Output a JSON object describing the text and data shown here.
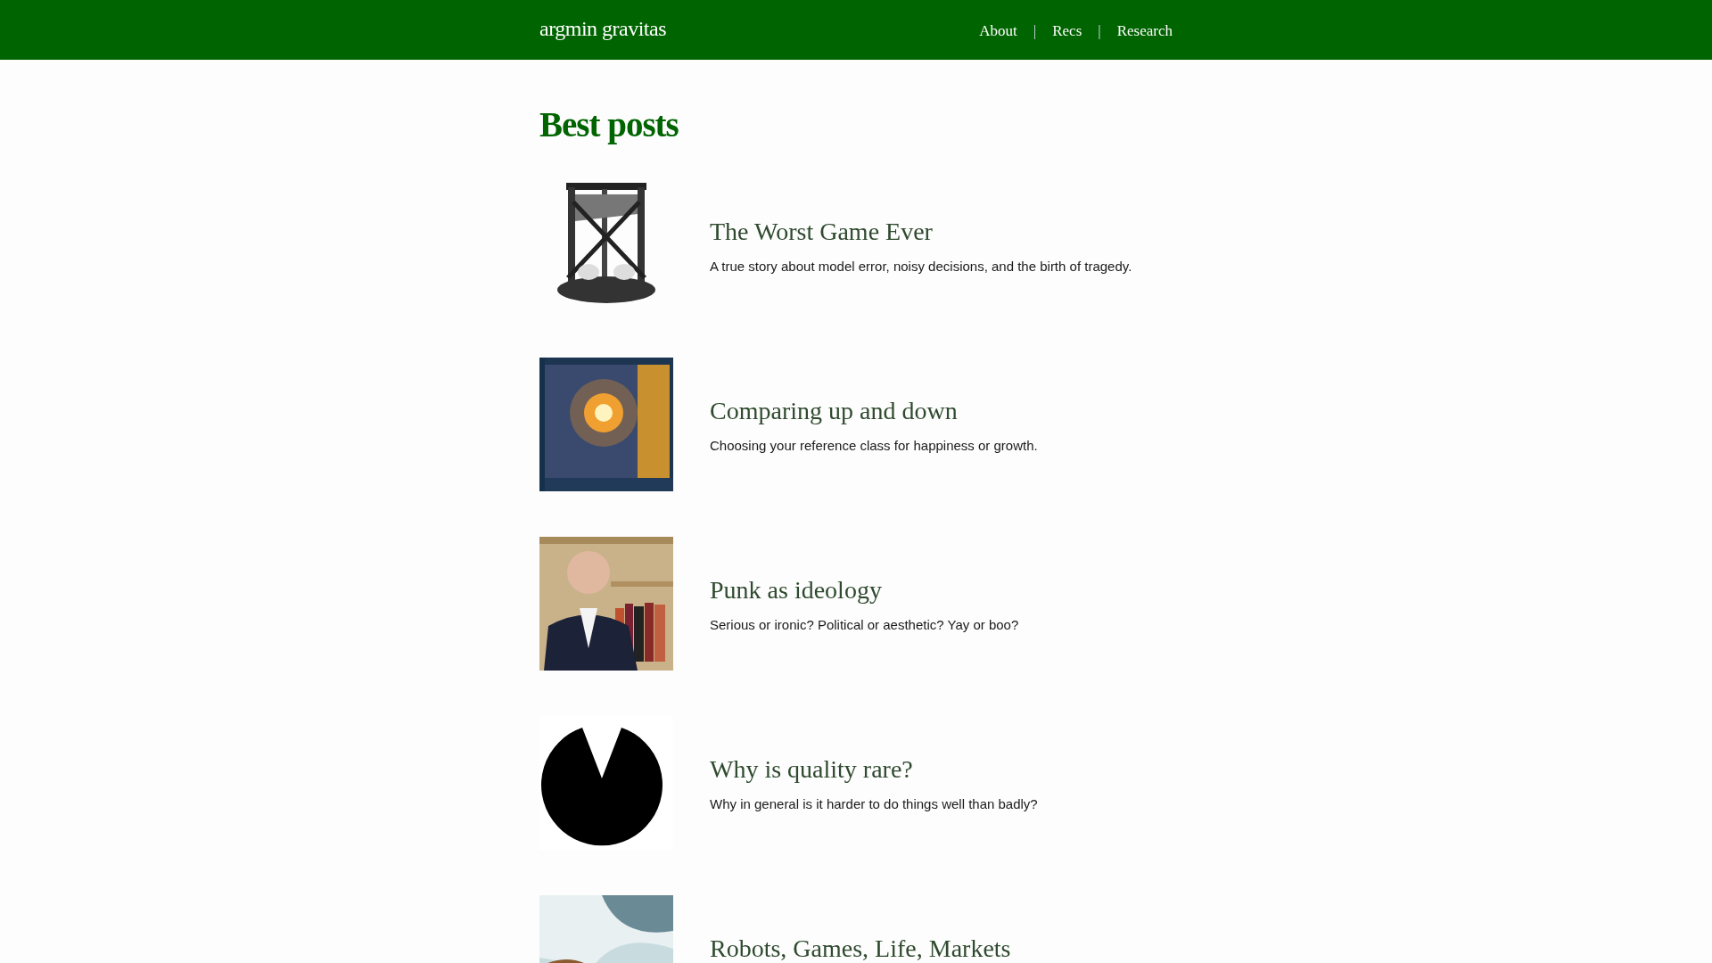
{
  "site_title": "argmin gravitas",
  "nav": [
    {
      "label": "About"
    },
    {
      "label": "|",
      "kind": "separator"
    },
    {
      "label": "Recs"
    },
    {
      "label": "|",
      "kind": "separator"
    },
    {
      "label": "Research"
    }
  ],
  "heading": "Best posts",
  "posts": [
    {
      "title": "The Worst Game Ever",
      "description": "A true story about model error, noisy decisions, and the birth of tragedy."
    },
    {
      "title": "Comparing up and down",
      "description": "Choosing your reference class for happiness or growth."
    },
    {
      "title": "Punk as ideology",
      "description": "Serious or ironic? Political or aesthetic? Yay or boo?"
    },
    {
      "title": "Why is quality rare?",
      "description": "Why in general is it harder to do things well than badly?"
    },
    {
      "title": "Robots, Games, Life, Markets"
    }
  ]
}
